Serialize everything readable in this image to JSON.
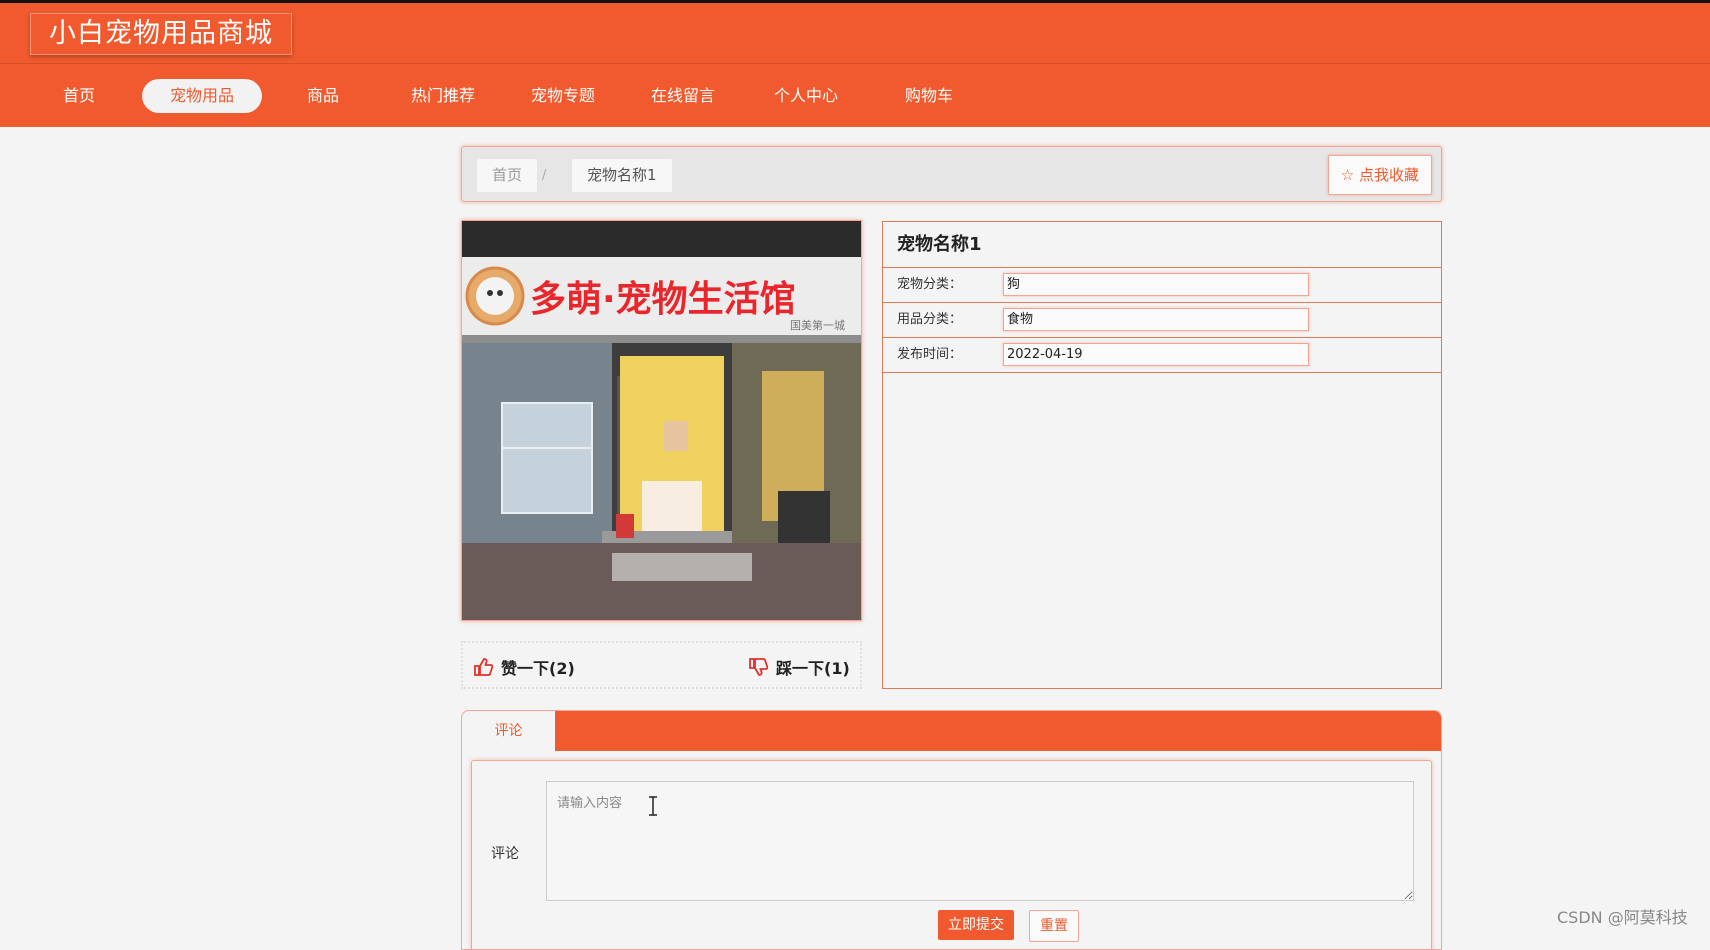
{
  "site": {
    "title": "小白宠物用品商城"
  },
  "nav": {
    "items": [
      {
        "label": "首页",
        "active": false
      },
      {
        "label": "宠物用品",
        "active": true
      },
      {
        "label": "商品",
        "active": false
      },
      {
        "label": "热门推荐",
        "active": false
      },
      {
        "label": "宠物专题",
        "active": false
      },
      {
        "label": "在线留言",
        "active": false
      },
      {
        "label": "个人中心",
        "active": false
      },
      {
        "label": "购物车",
        "active": false
      }
    ]
  },
  "breadcrumb": {
    "home": "首页",
    "separator": "/",
    "current": "宠物名称1"
  },
  "favorite": {
    "label": "☆ 点我收藏"
  },
  "product": {
    "image_sign": "多萌·宠物生活馆",
    "image_subsign": "国美第一城",
    "name": "宠物名称1",
    "fields": [
      {
        "label": "宠物分类：",
        "value": "狗"
      },
      {
        "label": "用品分类：",
        "value": "食物"
      },
      {
        "label": "发布时间：",
        "value": "2022-04-19"
      }
    ]
  },
  "votes": {
    "like": "赞一下(2)",
    "dislike": "踩一下(1)"
  },
  "comments": {
    "tab": "评论",
    "label": "评论",
    "placeholder": "请输入内容",
    "submit": "立即提交",
    "reset": "重置"
  },
  "watermark": "CSDN @阿莫科技",
  "colors": {
    "brand": "#f05a2e",
    "background": "#f4f4f4"
  }
}
